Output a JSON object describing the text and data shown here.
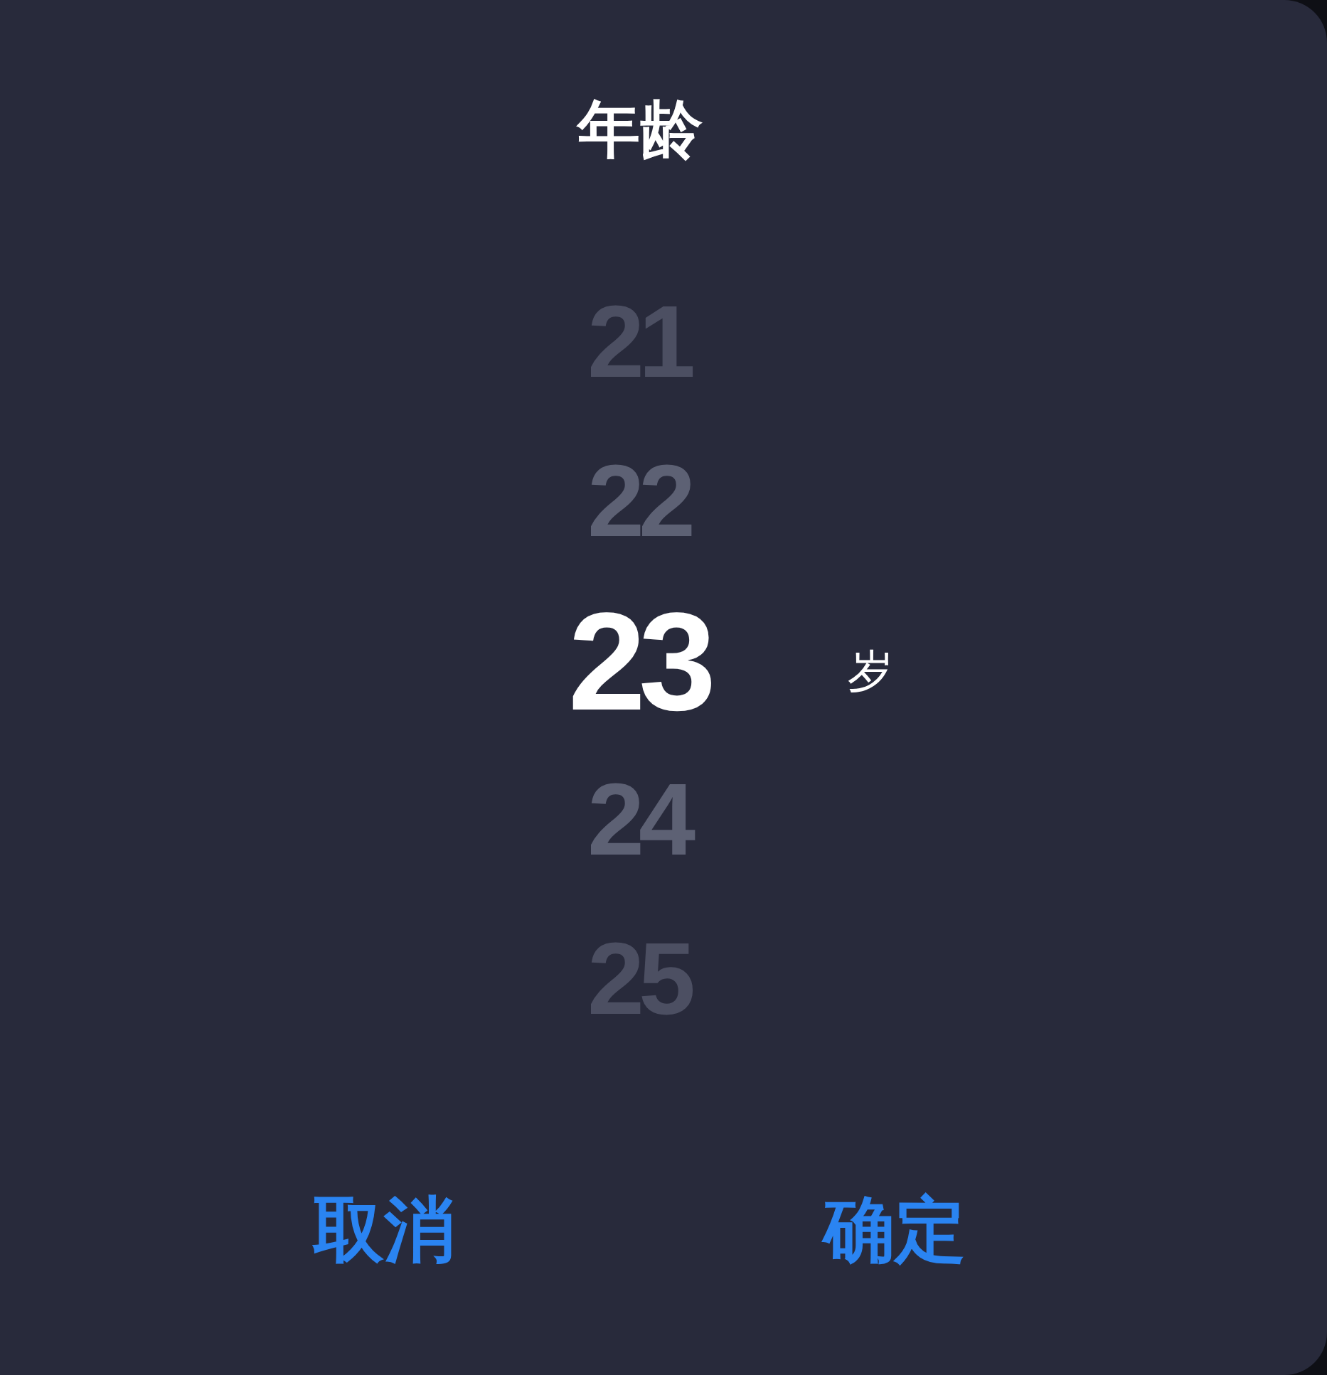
{
  "dialog": {
    "title": "年龄"
  },
  "picker": {
    "items": [
      {
        "label": "21",
        "selected": false
      },
      {
        "label": "22",
        "selected": false
      },
      {
        "label": "23",
        "selected": true
      },
      {
        "label": "24",
        "selected": false
      },
      {
        "label": "25",
        "selected": false
      }
    ],
    "unit": "岁"
  },
  "buttons": [
    "取消",
    "确定"
  ]
}
